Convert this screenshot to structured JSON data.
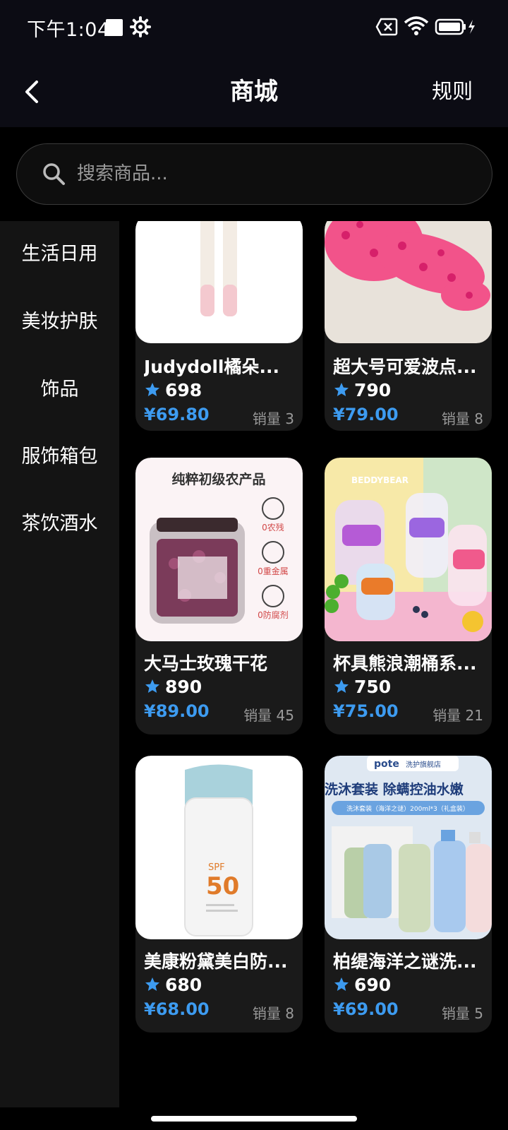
{
  "status_bar": {
    "time": "下午1:04"
  },
  "header": {
    "title": "商城",
    "rules_label": "规则"
  },
  "search": {
    "placeholder": "搜索商品..."
  },
  "sidebar": {
    "categories": [
      "生活日用",
      "美妆护肤",
      "饰品",
      "服饰箱包",
      "茶饮酒水"
    ]
  },
  "products": [
    {
      "name": "Judydoll橘朵...",
      "score": "698",
      "price": "¥69.80",
      "sales": "销量 3"
    },
    {
      "name": "超大号可爱波点...",
      "score": "790",
      "price": "¥79.00",
      "sales": "销量 8"
    },
    {
      "name": "大马士玫瑰干花",
      "score": "890",
      "price": "¥89.00",
      "sales": "销量 45",
      "img_text": {
        "headline": "纯粹初级农产品",
        "c1": "0农残",
        "c2": "0重金属",
        "c3": "0防腐剂"
      }
    },
    {
      "name": "杯具熊浪潮桶系...",
      "score": "750",
      "price": "¥75.00",
      "sales": "销量 21",
      "img_text": {
        "brand": "BEDDYBEAR"
      }
    },
    {
      "name": "美康粉黛美白防...",
      "score": "680",
      "price": "¥68.00",
      "sales": "销量 8",
      "img_text": {
        "spf": "50",
        "spf_label": "SPF"
      }
    },
    {
      "name": "柏缇海洋之谜洗...",
      "score": "690",
      "price": "¥69.00",
      "sales": "销量 5",
      "img_text": {
        "brand": "pote",
        "store": "洗护旗舰店",
        "headline": "洗沐套装 除螨控油水嫩",
        "sub": "洗沐套装（海洋之谜）200ml*3（礼盒装）"
      }
    }
  ],
  "colors": {
    "accent": "#3d9bf0",
    "background": "#000000",
    "sidebar": "#141414",
    "card": "#1a1a1a"
  }
}
